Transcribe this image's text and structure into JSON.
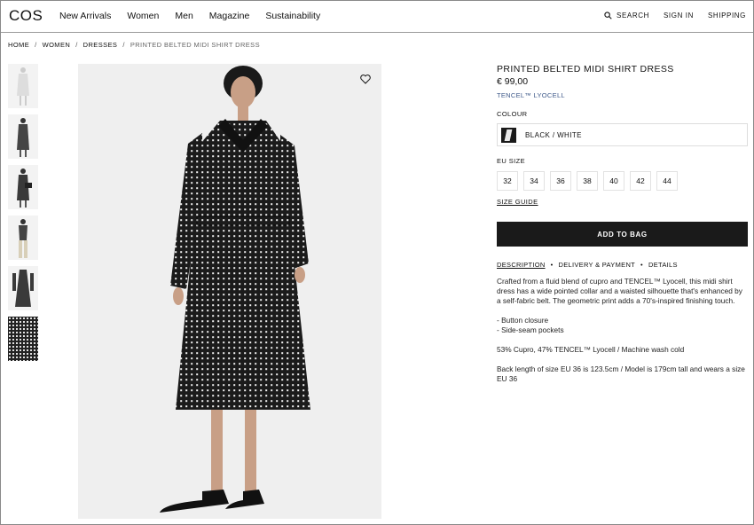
{
  "header": {
    "logo": "COS",
    "nav": [
      "New Arrivals",
      "Women",
      "Men",
      "Magazine",
      "Sustainability"
    ],
    "search_label": "SEARCH",
    "sign_in_label": "SIGN IN",
    "shipping_label": "SHIPPING"
  },
  "breadcrumb": {
    "home": "HOME",
    "women": "WOMEN",
    "dresses": "DRESSES",
    "current": "PRINTED BELTED MIDI SHIRT DRESS",
    "separator": "/"
  },
  "product": {
    "title": "PRINTED BELTED MIDI SHIRT DRESS",
    "price": "€ 99,00",
    "fabric": "TENCEL™ LYOCELL",
    "colour_label": "COLOUR",
    "colour_value": "BLACK / WHITE",
    "size_label": "EU SIZE",
    "sizes": [
      "32",
      "34",
      "36",
      "38",
      "40",
      "42",
      "44"
    ],
    "size_guide": "SIZE GUIDE",
    "add_to_bag": "ADD TO BAG",
    "tabs": [
      "DESCRIPTION",
      "DELIVERY & PAYMENT",
      "DETAILS"
    ],
    "tab_separator": "•",
    "description": "Crafted from a fluid blend of cupro and TENCEL™ Lyocell, this midi shirt dress has a wide pointed collar and a waisted silhouette that's enhanced by a self-fabric belt. The geometric print adds a 70's-inspired finishing touch.",
    "features": [
      "- Button closure",
      "- Side-seam pockets"
    ],
    "composition": "53% Cupro, 47% TENCEL™ Lyocell / Machine wash cold",
    "measurements": "Back length of size EU 36 is 123.5cm / Model is 179cm tall and wears a size EU 36"
  },
  "colors": {
    "accent_link": "#3f5a8a",
    "button_bg": "#1a1a1a",
    "image_bg": "#efefef"
  }
}
